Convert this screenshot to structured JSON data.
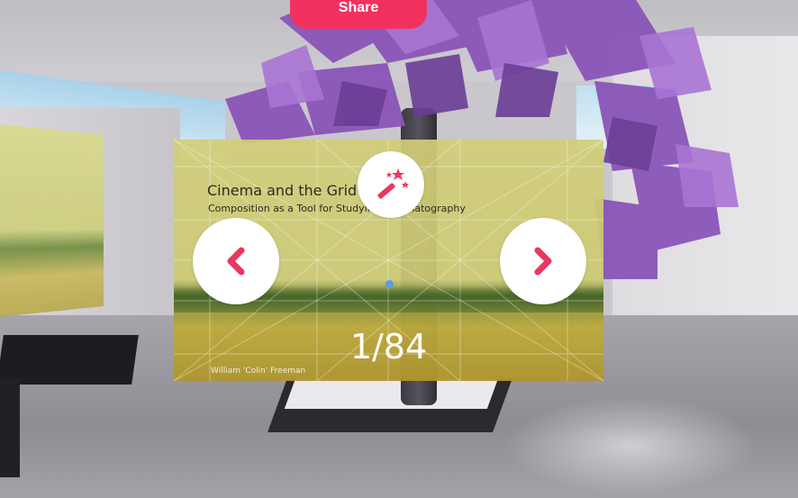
{
  "toolbar": {
    "share_label": "Share"
  },
  "slide": {
    "title": "Cinema and the Grid",
    "subtitle": "Composition as a Tool for Studying Cinematography",
    "author": "William 'Colin' Freeman"
  },
  "navigation": {
    "counter": "1/84",
    "prev_icon": "chevron-left-icon",
    "next_icon": "chevron-right-icon",
    "effects_icon": "magic-wand-icon"
  },
  "colors": {
    "accent": "#f2315f",
    "pointer": "#5a9fe0"
  }
}
